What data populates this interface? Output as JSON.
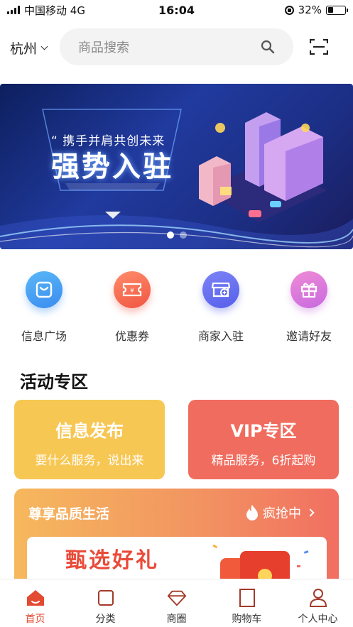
{
  "status_bar": {
    "carrier": "中国移动",
    "network": "4G",
    "time": "16:04",
    "battery": "32%",
    "battery_level": 0.32
  },
  "header": {
    "city": "杭州",
    "search_placeholder": "商品搜索",
    "icons": {
      "city_dropdown": "chevron-down-icon",
      "search": "search-icon",
      "scan": "scan-icon"
    }
  },
  "banner": {
    "subtitle": "携手并肩共创未来",
    "title": "强势入驻",
    "slide_count": 2,
    "active_slide": 1
  },
  "quick_menu": [
    {
      "label": "信息广场",
      "icon": "bag-icon",
      "color_from": "#5ab8f7",
      "color_to": "#3a8cf0"
    },
    {
      "label": "优惠券",
      "icon": "coupon-icon",
      "color_from": "#ff8c6b",
      "color_to": "#f05541"
    },
    {
      "label": "商家入驻",
      "icon": "store-icon",
      "color_from": "#7c83f6",
      "color_to": "#5660ea"
    },
    {
      "label": "邀请好友",
      "icon": "gift-icon",
      "color_from": "#f08bd6",
      "color_to": "#c76adf"
    }
  ],
  "activity": {
    "title": "活动专区",
    "cards": [
      {
        "title": "信息发布",
        "subtitle": "要什么服务，说出来",
        "color": "#f7c754"
      },
      {
        "title": "VIP专区",
        "subtitle": "精品服务，6折起购",
        "color": "#f06c5e"
      }
    ],
    "promo": {
      "title": "尊享品质生活",
      "more": "疯抢中",
      "inner_text": "甄选好礼"
    }
  },
  "tabbar": [
    {
      "label": "首页",
      "icon": "home-icon",
      "active": true
    },
    {
      "label": "分类",
      "icon": "category-icon",
      "active": false
    },
    {
      "label": "商圈",
      "icon": "diamond-icon",
      "active": false
    },
    {
      "label": "购物车",
      "icon": "cart-icon",
      "active": false
    },
    {
      "label": "个人中心",
      "icon": "user-icon",
      "active": false
    }
  ],
  "colors": {
    "accent": "#e24a31",
    "banner_bg": "#1c2f86"
  }
}
